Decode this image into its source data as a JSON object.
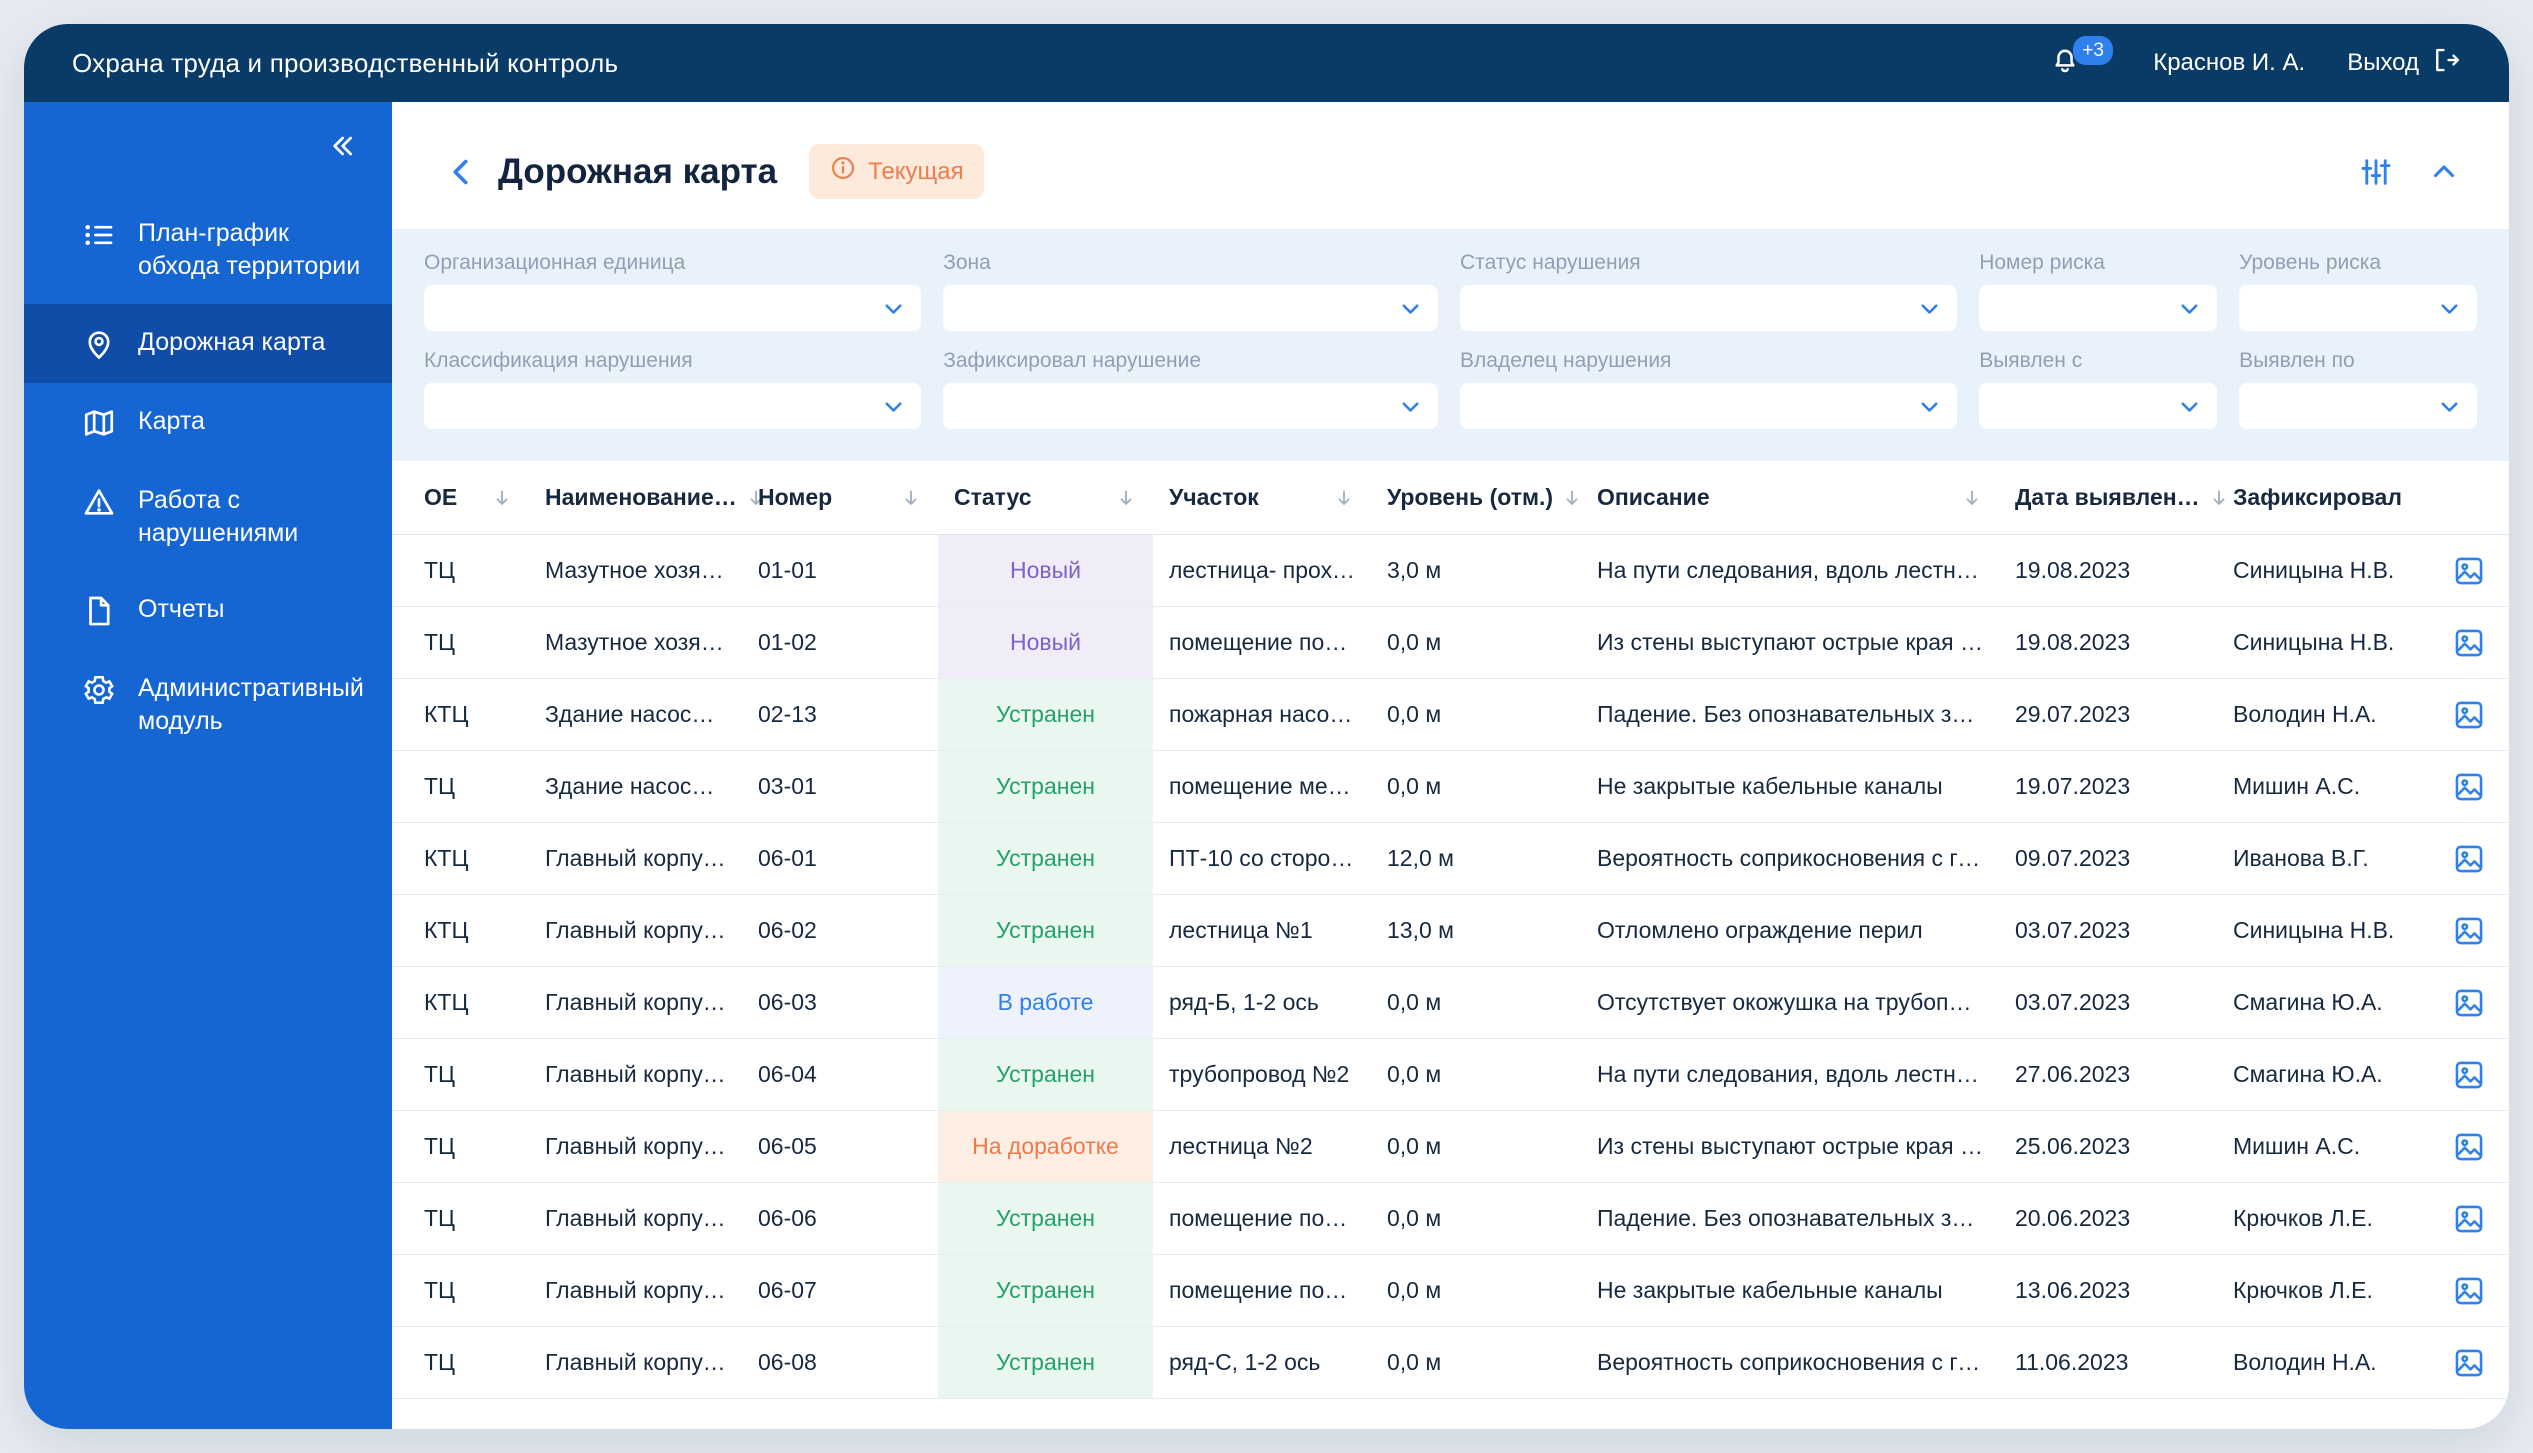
{
  "app": {
    "title": "Охрана труда и производственный контроль",
    "notifications_badge": "+3",
    "user_name": "Краснов И. А.",
    "logout_label": "Выход"
  },
  "sidebar": {
    "items": [
      {
        "label": "План-график обхода территории",
        "icon": "checklist",
        "active": false
      },
      {
        "label": "Дорожная карта",
        "icon": "location-pin",
        "active": true
      },
      {
        "label": "Карта",
        "icon": "map",
        "active": false
      },
      {
        "label": "Работа с нарушениями",
        "icon": "warning-triangle",
        "active": false
      },
      {
        "label": "Отчеты",
        "icon": "document",
        "active": false
      },
      {
        "label": "Административный модуль",
        "icon": "gear",
        "active": false
      }
    ]
  },
  "page": {
    "title": "Дорожная карта",
    "status_badge": "Текущая"
  },
  "filters": {
    "row1": [
      "Организационная единица",
      "Зона",
      "Статус нарушения",
      "Номер риска",
      "Уровень риска"
    ],
    "row2": [
      "Классификация нарушения",
      "Зафиксировал нарушение",
      "Владелец нарушения",
      "Выявлен с",
      "Выявлен по"
    ]
  },
  "table": {
    "columns": [
      {
        "label": "ОЕ",
        "sortable": true
      },
      {
        "label": "Наименование…",
        "sortable": true
      },
      {
        "label": "Номер",
        "sortable": true
      },
      {
        "label": "Статус",
        "sortable": true
      },
      {
        "label": "Участок",
        "sortable": true
      },
      {
        "label": "Уровень (отм.)",
        "sortable": true
      },
      {
        "label": "Описание",
        "sortable": true
      },
      {
        "label": "Дата выявлен…",
        "sortable": true
      },
      {
        "label": "Зафиксировал",
        "sortable": false
      }
    ],
    "rows": [
      {
        "oe": "ТЦ",
        "name": "Мазутное хозяйст…",
        "number": "01-01",
        "status": "Новый",
        "status_type": "new",
        "area": "лестница- проход…",
        "level": "3,0 м",
        "description": "На пути следования, вдоль лестницы пр…",
        "date": "19.08.2023",
        "recorded_by": "Синицына Н.В."
      },
      {
        "oe": "ТЦ",
        "name": "Мазутное хозяйст…",
        "number": "01-02",
        "status": "Новый",
        "status_type": "new",
        "area": "помещение поноо…",
        "level": "0,0 м",
        "description": "Из стены выступают острые края армат…",
        "date": "19.08.2023",
        "recorded_by": "Синицына Н.В."
      },
      {
        "oe": "КТЦ",
        "name": "Здание насосной…",
        "number": "02-13",
        "status": "Устранен",
        "status_type": "fixed",
        "area": "пожарная насосн…",
        "level": "0,0 м",
        "description": "Падение. Без опознавательных знаков…",
        "date": "29.07.2023",
        "recorded_by": "Володин Н.А."
      },
      {
        "oe": "ТЦ",
        "name": "Здание насосной…",
        "number": "03-01",
        "status": "Устранен",
        "status_type": "fixed",
        "area": "помещение местн…",
        "level": "0,0 м",
        "description": "Не закрытые кабельные каналы",
        "date": "19.07.2023",
        "recorded_by": "Мишин А.С."
      },
      {
        "oe": "КТЦ",
        "name": "Главный корпус, б…",
        "number": "06-01",
        "status": "Устранен",
        "status_type": "fixed",
        "area": "ПТ-10 со стороны…",
        "level": "12,0 м",
        "description": "Вероятность соприкосновения с горяче…",
        "date": "09.07.2023",
        "recorded_by": "Иванова В.Г."
      },
      {
        "oe": "КТЦ",
        "name": "Главный корпус, б…",
        "number": "06-02",
        "status": "Устранен",
        "status_type": "fixed",
        "area": "лестница №1",
        "level": "13,0 м",
        "description": "Отломлено ограждение перил",
        "date": "03.07.2023",
        "recorded_by": "Синицына Н.В."
      },
      {
        "oe": "КТЦ",
        "name": "Главный корпус, б…",
        "number": "06-03",
        "status": "В работе",
        "status_type": "in_work",
        "area": "ряд-Б, 1-2 ось",
        "level": "0,0 м",
        "description": "Отсутствует окожушка на трубопроводе",
        "date": "03.07.2023",
        "recorded_by": "Смагина Ю.А."
      },
      {
        "oe": "ТЦ",
        "name": "Главный корпус, б…",
        "number": "06-04",
        "status": "Устранен",
        "status_type": "fixed",
        "area": "трубопровод №2",
        "level": "0,0 м",
        "description": "На пути следования, вдоль лестницы пр…",
        "date": "27.06.2023",
        "recorded_by": "Смагина Ю.А."
      },
      {
        "oe": "ТЦ",
        "name": "Главный корпус, б…",
        "number": "06-05",
        "status": "На доработке",
        "status_type": "rework",
        "area": "лестница №2",
        "level": "0,0 м",
        "description": "Из стены выступают острые края армат…",
        "date": "25.06.2023",
        "recorded_by": "Мишин А.С."
      },
      {
        "oe": "ТЦ",
        "name": "Главный корпус, б…",
        "number": "06-06",
        "status": "Устранен",
        "status_type": "fixed",
        "area": "помещение поноо…",
        "level": "0,0 м",
        "description": "Падение. Без опознавательных знаков…",
        "date": "20.06.2023",
        "recorded_by": "Крючков Л.Е."
      },
      {
        "oe": "ТЦ",
        "name": "Главный корпус, б…",
        "number": "06-07",
        "status": "Устранен",
        "status_type": "fixed",
        "area": "помещение поноо…",
        "level": "0,0 м",
        "description": "Не закрытые кабельные каналы",
        "date": "13.06.2023",
        "recorded_by": "Крючков Л.Е."
      },
      {
        "oe": "ТЦ",
        "name": "Главный корпус, б…",
        "number": "06-08",
        "status": "Устранен",
        "status_type": "fixed",
        "area": "ряд-С, 1-2 ось",
        "level": "0,0 м",
        "description": "Вероятность соприкосновения с горяче…",
        "date": "11.06.2023",
        "recorded_by": "Володин Н.А."
      }
    ]
  },
  "status_styles": {
    "new": {
      "text": "#7a64c9",
      "bg": "#f0ecf8"
    },
    "fixed": {
      "text": "#27a06b",
      "bg": "#e9f7f0"
    },
    "in_work": {
      "text": "#2f80ed",
      "bg": "#edf2fc"
    },
    "rework": {
      "text": "#f0794a",
      "bg": "#fdeee4"
    }
  },
  "colors": {
    "accent": "#2f80ed",
    "topbar": "#0a3a66",
    "sidebar": "#1565d2",
    "sidebar_active": "#0f4da8",
    "filters_bg": "#e9f2fb",
    "badge_bg": "#fdeadb",
    "badge_text": "#ee7d4d"
  }
}
